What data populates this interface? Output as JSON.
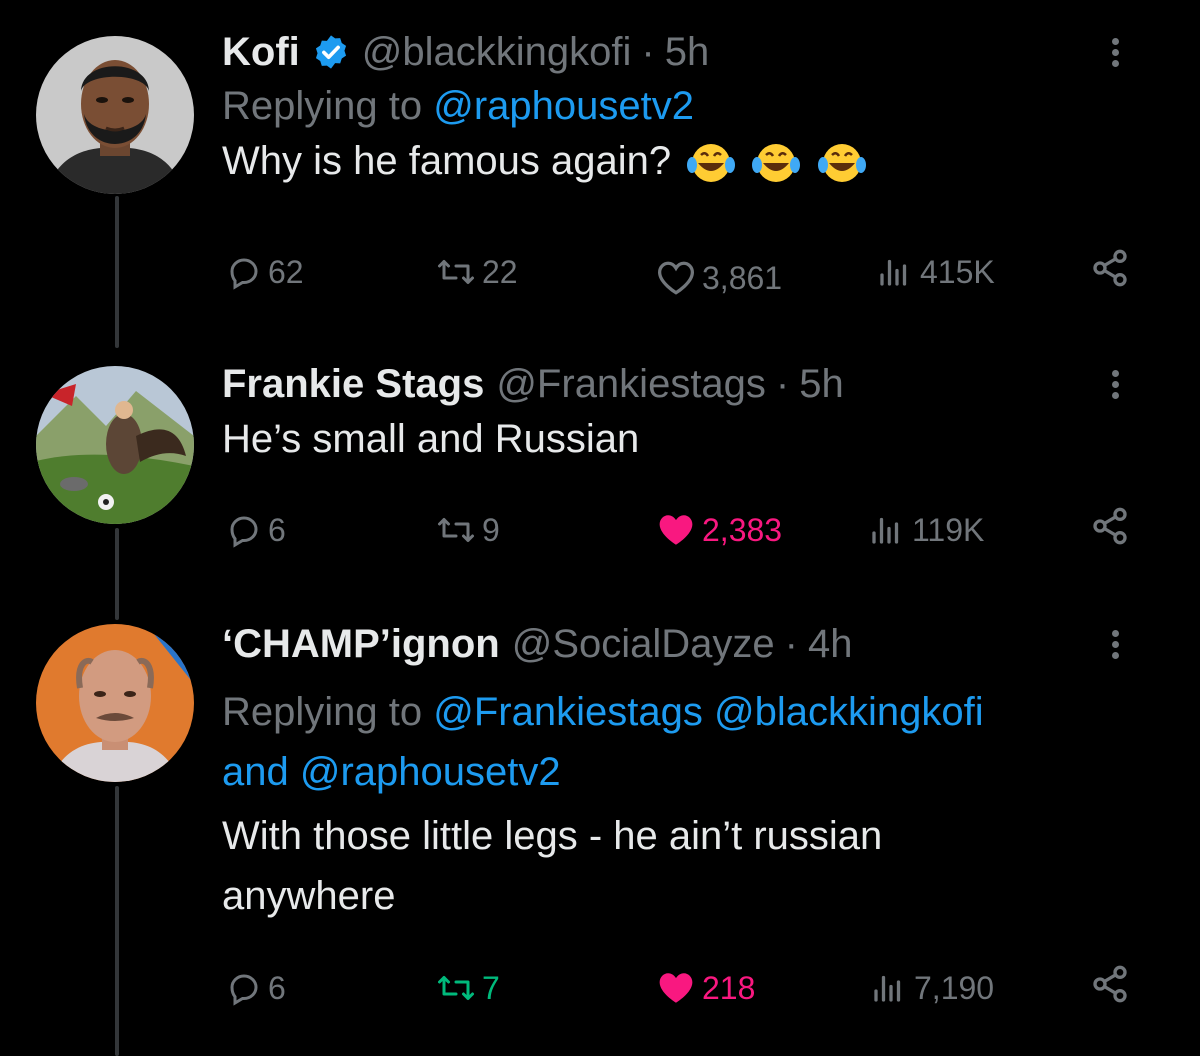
{
  "colors": {
    "bg": "#000000",
    "text": "#e7e9ea",
    "muted": "#71767b",
    "link": "#1d9bf0",
    "like": "#f91880",
    "retweet": "#00ba7c"
  },
  "tweets": [
    {
      "name": "Kofi",
      "verified": true,
      "handle": "@blackkingkofi",
      "dot": "·",
      "time": "5h",
      "reply_prefix": "Replying to",
      "reply_to": "@raphousetv2",
      "text": "Why is he famous again?",
      "emoji": "face-with-tears-of-joy x3",
      "replies": "62",
      "retweets": "22",
      "likes": "3,861",
      "views": "415K",
      "liked": false,
      "retweeted": false
    },
    {
      "name": "Frankie Stags",
      "handle": "@Frankiestags",
      "dot": "·",
      "time": "5h",
      "text": "He’s small and Russian",
      "replies": "6",
      "retweets": "9",
      "likes": "2,383",
      "views": "119K",
      "liked": true,
      "retweeted": false
    },
    {
      "name": "‘CHAMP’ignon",
      "handle": "@SocialDayze",
      "dot": "·",
      "time": "4h",
      "reply_prefix": "Replying to",
      "reply_to_1": "@Frankiestags",
      "reply_to_2": "@blackkingkofi",
      "reply_and": "and",
      "reply_to_3": "@raphousetv2",
      "text_line1": "With those little legs - he ain’t russian",
      "text_line2": "anywhere",
      "replies": "6",
      "retweets": "7",
      "likes": "218",
      "views": "7,190",
      "liked": true,
      "retweeted": true
    }
  ],
  "icons": [
    "reply-icon",
    "retweet-icon",
    "like-icon",
    "views-icon",
    "share-icon",
    "more-icon",
    "verified-icon"
  ]
}
